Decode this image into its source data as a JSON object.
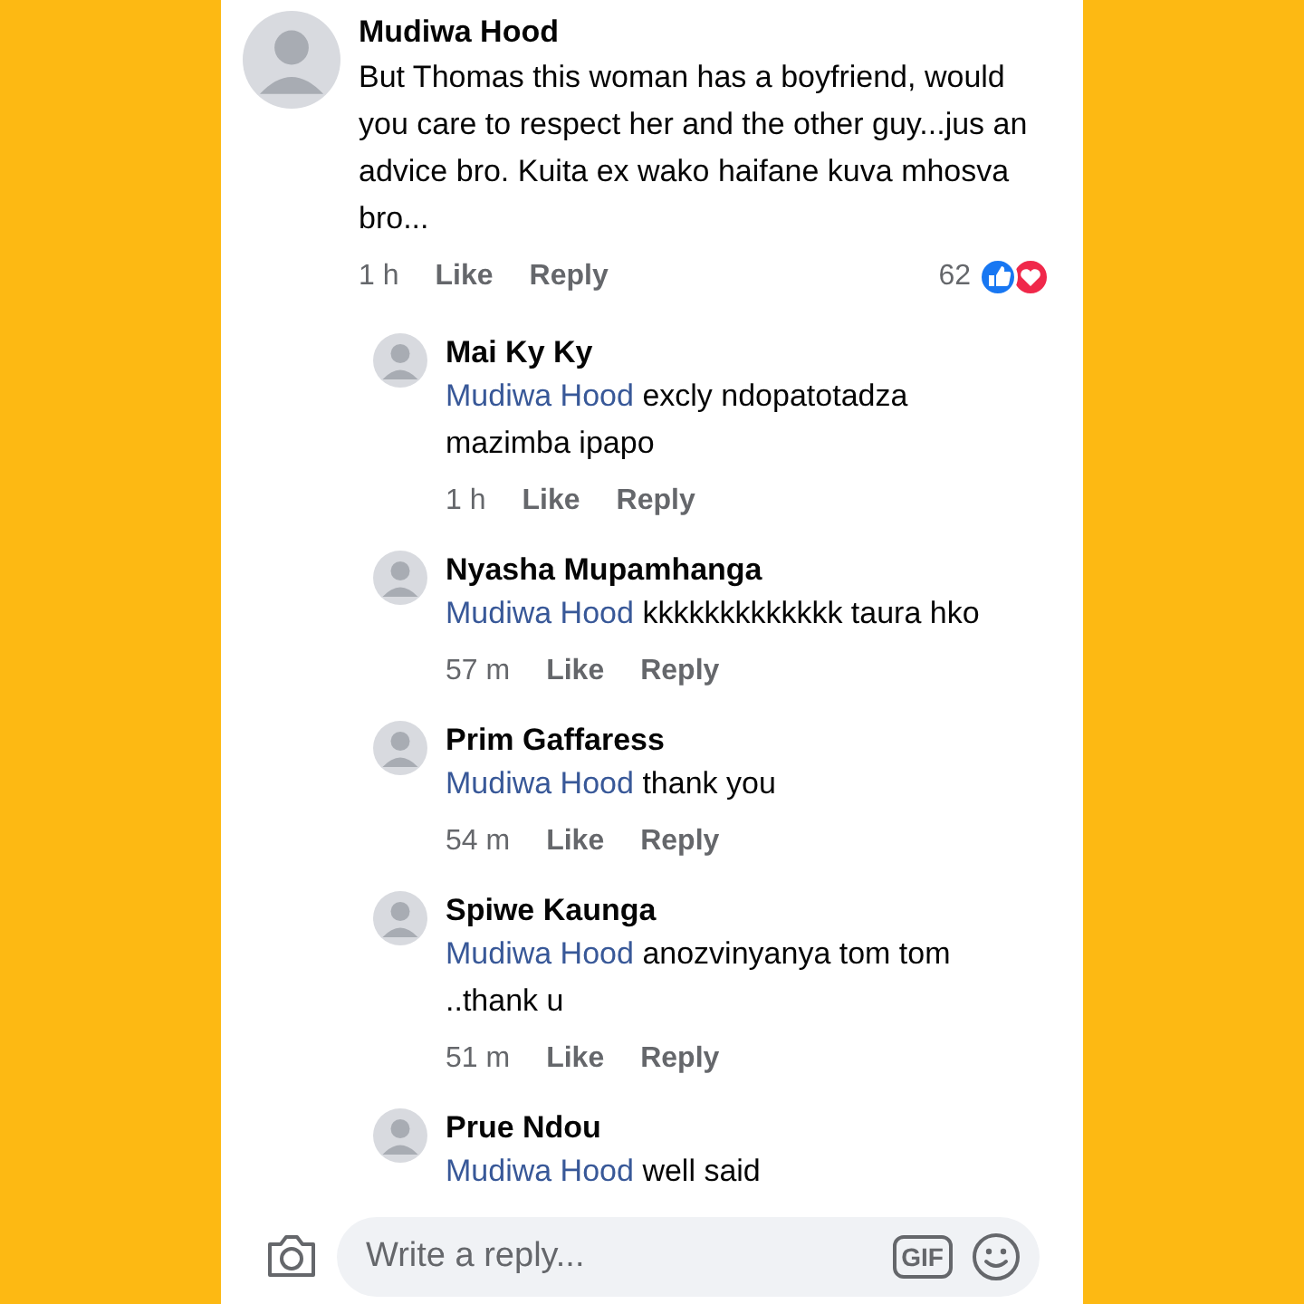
{
  "comment": {
    "author": "Mudiwa Hood",
    "text": "But Thomas this woman has a boyfriend, would you care to respect her and the other guy...jus an advice bro. Kuita ex wako haifane kuva mhosva bro...",
    "time": "1 h",
    "like": "Like",
    "reply": "Reply",
    "reaction_count": "62"
  },
  "replies": [
    {
      "author": "Mai Ky Ky",
      "mention": "Mudiwa Hood",
      "text": "excly ndopatotadza mazimba ipapo",
      "time": "1 h",
      "like": "Like",
      "reply": "Reply"
    },
    {
      "author": "Nyasha Mupamhanga",
      "mention": "Mudiwa Hood",
      "text": "kkkkkkkkkkkkk taura hko",
      "time": "57 m",
      "like": "Like",
      "reply": "Reply"
    },
    {
      "author": "Prim Gaffaress",
      "mention": "Mudiwa Hood",
      "text": "thank you",
      "time": "54 m",
      "like": "Like",
      "reply": "Reply"
    },
    {
      "author": "Spiwe Kaunga",
      "mention": "Mudiwa Hood",
      "text": "anozvinyanya tom tom ..thank u",
      "time": "51 m",
      "like": "Like",
      "reply": "Reply"
    },
    {
      "author": "Prue Ndou",
      "mention": "Mudiwa Hood",
      "text": "well said"
    }
  ],
  "composer": {
    "placeholder": "Write a reply...",
    "gif": "GIF"
  }
}
